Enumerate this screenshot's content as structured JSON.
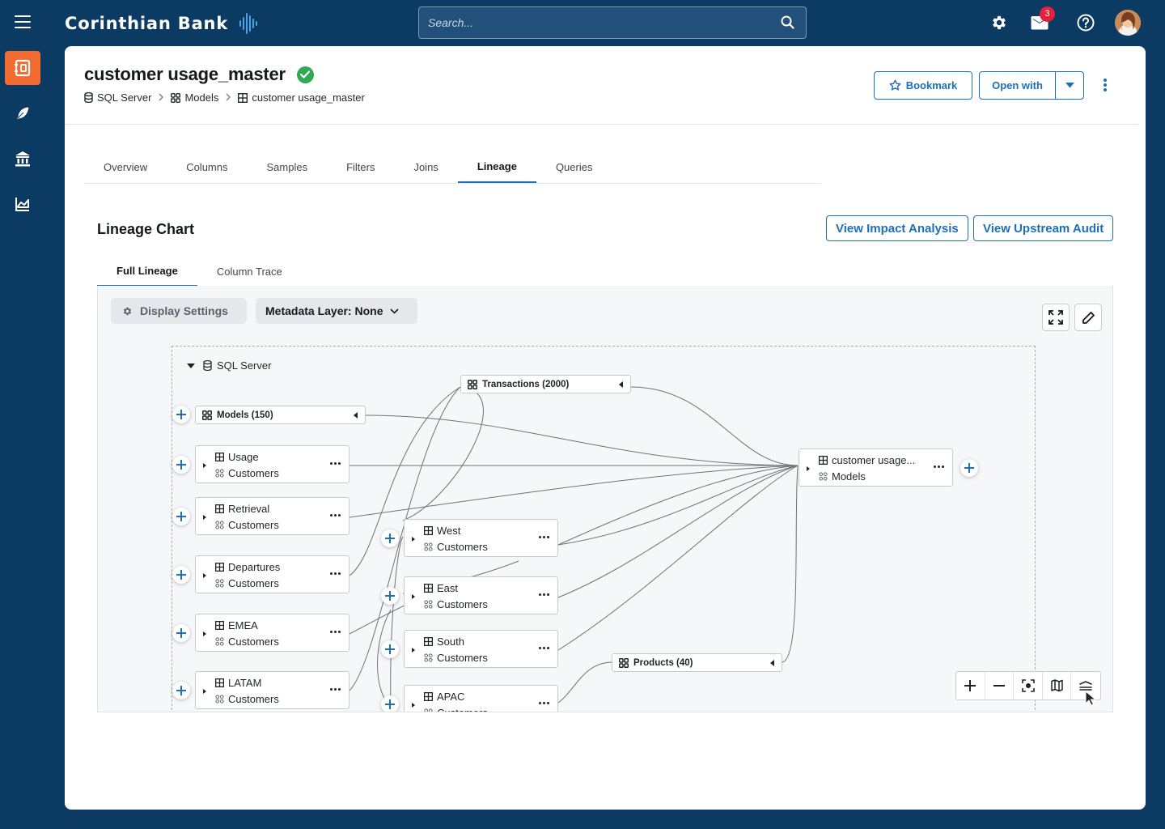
{
  "app": {
    "name": "Corinthian Bank",
    "notification_count": "3"
  },
  "search": {
    "placeholder": "Search..."
  },
  "asset": {
    "title": "customer usage_master",
    "breadcrumb": [
      "SQL Server",
      "Models",
      "customer usage_master"
    ],
    "actions": {
      "bookmark": "Bookmark",
      "open_with": "Open with"
    }
  },
  "tabs": [
    "Overview",
    "Columns",
    "Samples",
    "Filters",
    "Joins",
    "Lineage",
    "Queries"
  ],
  "active_tab": "Lineage",
  "lineage": {
    "title": "Lineage Chart",
    "buttons": {
      "impact": "View Impact Analysis",
      "upstream": "View Upstream Audit"
    },
    "subtabs": [
      "Full Lineage",
      "Column Trace"
    ],
    "active_subtab": "Full Lineage",
    "display_settings": "Display Settings",
    "metadata_layer": "Metadata Layer: None",
    "group_label": "SQL Server",
    "groups": {
      "models": "Models (150)",
      "transactions": "Transactions (2000)",
      "products": "Products (40)"
    },
    "nodes": {
      "usage": {
        "name": "Usage",
        "type": "Customers"
      },
      "retrieval": {
        "name": "Retrieval",
        "type": "Customers"
      },
      "departures": {
        "name": "Departures",
        "type": "Customers"
      },
      "emea": {
        "name": "EMEA",
        "type": "Customers"
      },
      "latam": {
        "name": "LATAM",
        "type": "Customers"
      },
      "west": {
        "name": "West",
        "type": "Customers"
      },
      "east": {
        "name": "East",
        "type": "Customers"
      },
      "south": {
        "name": "South",
        "type": "Customers"
      },
      "apac": {
        "name": "APAC",
        "type": "Customers"
      },
      "target": {
        "name": "customer usage...",
        "type": "Models"
      }
    }
  },
  "colors": {
    "brand_navy": "#0b3a63",
    "accent_blue": "#1d6fb8",
    "active_orange": "#f36b31",
    "success_green": "#32a852",
    "badge_red": "#e5203a"
  },
  "icons": [
    "menu-icon",
    "settings-icon",
    "inbox-icon",
    "help-icon",
    "search-icon",
    "catalog-icon",
    "feather-icon",
    "bank-icon",
    "chart-icon",
    "star-icon",
    "database-icon",
    "grid-icon",
    "table-icon",
    "gear-icon",
    "expand-icon",
    "pencil-icon",
    "zoom-in-icon",
    "zoom-out-icon",
    "fit-icon",
    "map-icon",
    "layers-icon"
  ]
}
